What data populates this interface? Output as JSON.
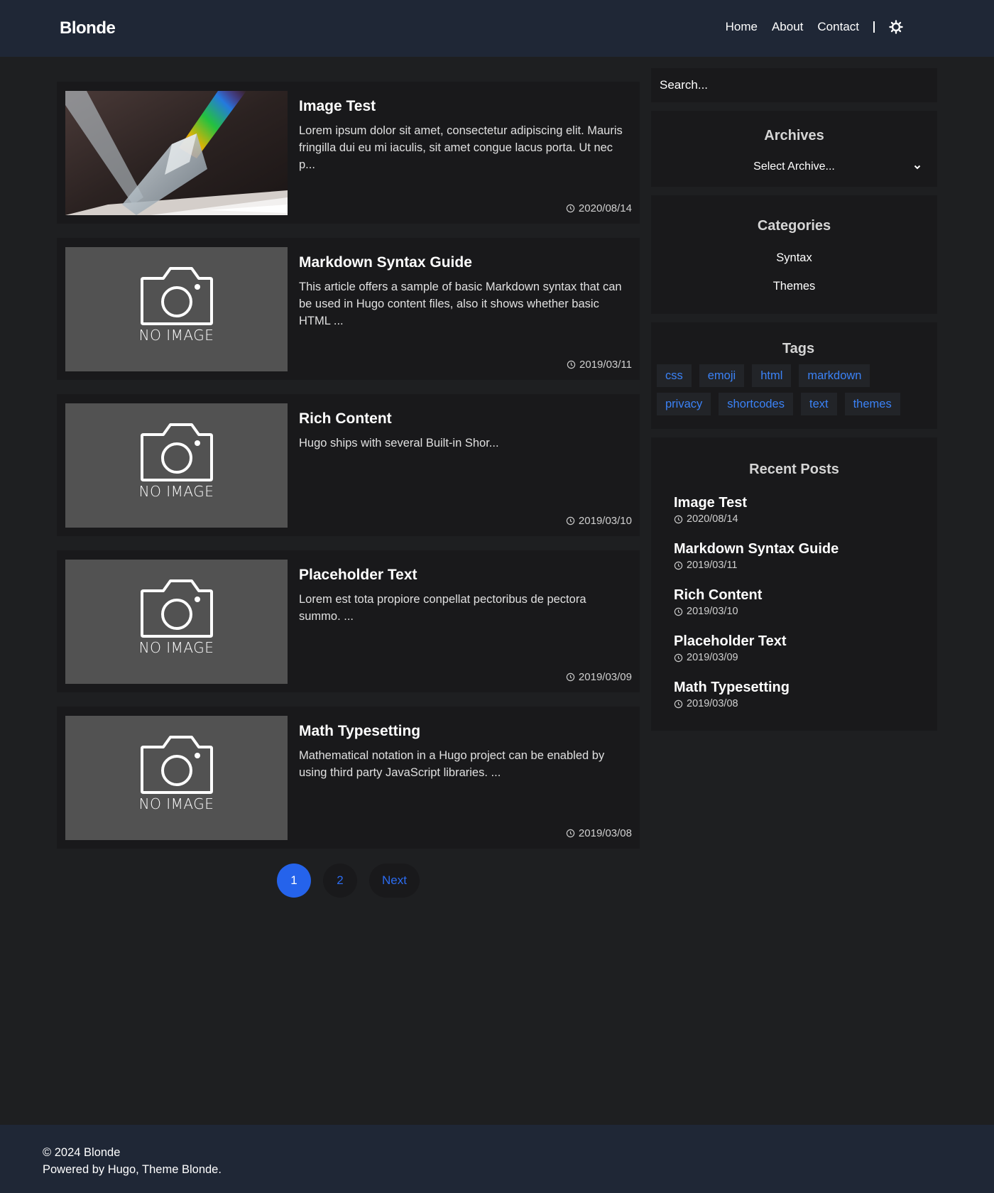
{
  "site": {
    "brand": "Blonde"
  },
  "nav": {
    "items": [
      "Home",
      "About",
      "Contact"
    ],
    "theme_icon": "sun-icon"
  },
  "posts": [
    {
      "title": "Image Test",
      "excerpt": "Lorem ipsum dolor sit amet, consectetur adipiscing elit. Mauris fringilla dui eu mi iaculis, sit amet congue lacus porta. Ut nec p...",
      "date": "2020/08/14",
      "image": "prism-photo"
    },
    {
      "title": "Markdown Syntax Guide",
      "excerpt": "This article offers a sample of basic Markdown syntax that can be used in Hugo content files, also it shows whether basic HTML ...",
      "date": "2019/03/11",
      "image": "no-image",
      "noimage_label": "NO IMAGE"
    },
    {
      "title": "Rich Content",
      "excerpt": "Hugo ships with several Built-in Shor...",
      "date": "2019/03/10",
      "image": "no-image",
      "noimage_label": "NO IMAGE"
    },
    {
      "title": "Placeholder Text",
      "excerpt": "Lorem est tota propiore conpellat pectoribus de pectora summo. ...",
      "date": "2019/03/09",
      "image": "no-image",
      "noimage_label": "NO IMAGE"
    },
    {
      "title": "Math Typesetting",
      "excerpt": "Mathematical notation in a Hugo project can be enabled by using third party JavaScript libraries. ...",
      "date": "2019/03/08",
      "image": "no-image",
      "noimage_label": "NO IMAGE"
    }
  ],
  "pagination": {
    "pages": [
      "1",
      "2"
    ],
    "current": "1",
    "next_label": "Next"
  },
  "sidebar": {
    "search_placeholder": "Search...",
    "archives": {
      "title": "Archives",
      "select_label": "Select Archive..."
    },
    "categories": {
      "title": "Categories",
      "items": [
        "Syntax",
        "Themes"
      ]
    },
    "tags": {
      "title": "Tags",
      "rows": [
        [
          "css",
          "emoji",
          "html",
          "markdown"
        ],
        [
          "privacy",
          "shortcodes",
          "text",
          "themes"
        ]
      ]
    },
    "recent": {
      "title": "Recent Posts",
      "items": [
        {
          "title": "Image Test",
          "date": "2020/08/14"
        },
        {
          "title": "Markdown Syntax Guide",
          "date": "2019/03/11"
        },
        {
          "title": "Rich Content",
          "date": "2019/03/10"
        },
        {
          "title": "Placeholder Text",
          "date": "2019/03/09"
        },
        {
          "title": "Math Typesetting",
          "date": "2019/03/08"
        }
      ]
    }
  },
  "footer": {
    "copyright": "© 2024 Blonde",
    "powered": "Powered by Hugo, Theme Blonde."
  },
  "colors": {
    "header_bg": "#1f2736",
    "accent": "#2563eb",
    "tag_text": "#3b82f6",
    "card_bg": "#19191b"
  }
}
